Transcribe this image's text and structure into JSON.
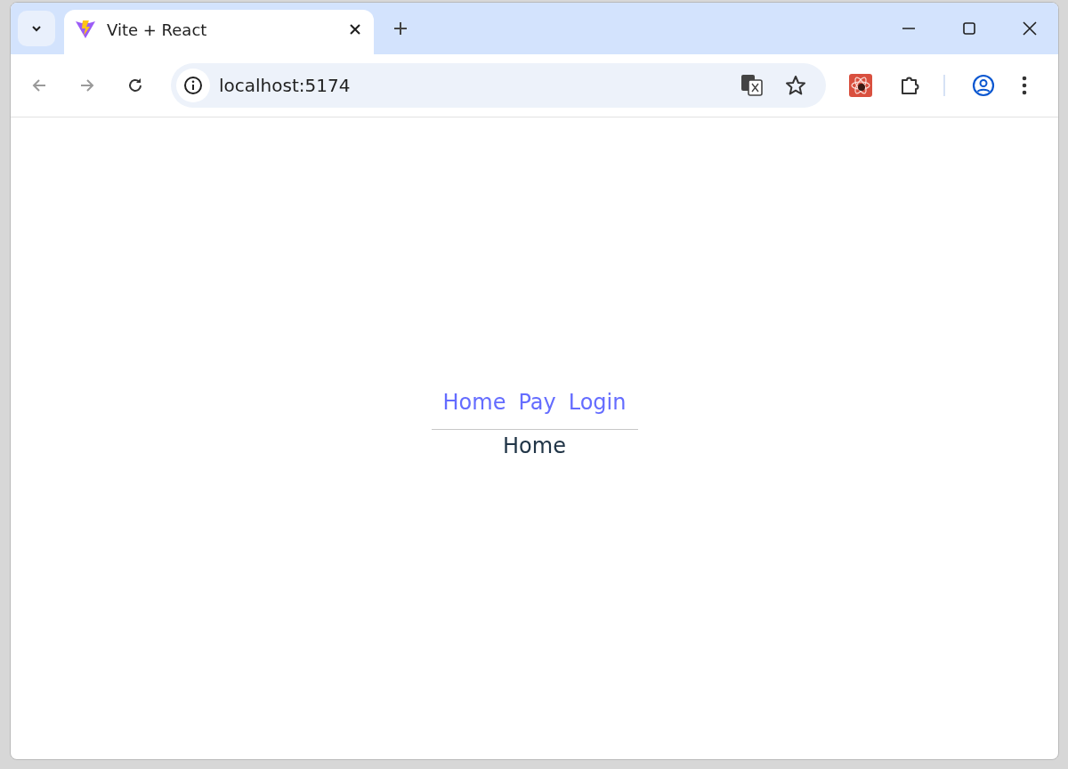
{
  "tab": {
    "title": "Vite + React"
  },
  "address_bar": {
    "url": "localhost:5174"
  },
  "page": {
    "nav_links": [
      "Home",
      "Pay",
      "Login"
    ],
    "route_content": "Home"
  }
}
